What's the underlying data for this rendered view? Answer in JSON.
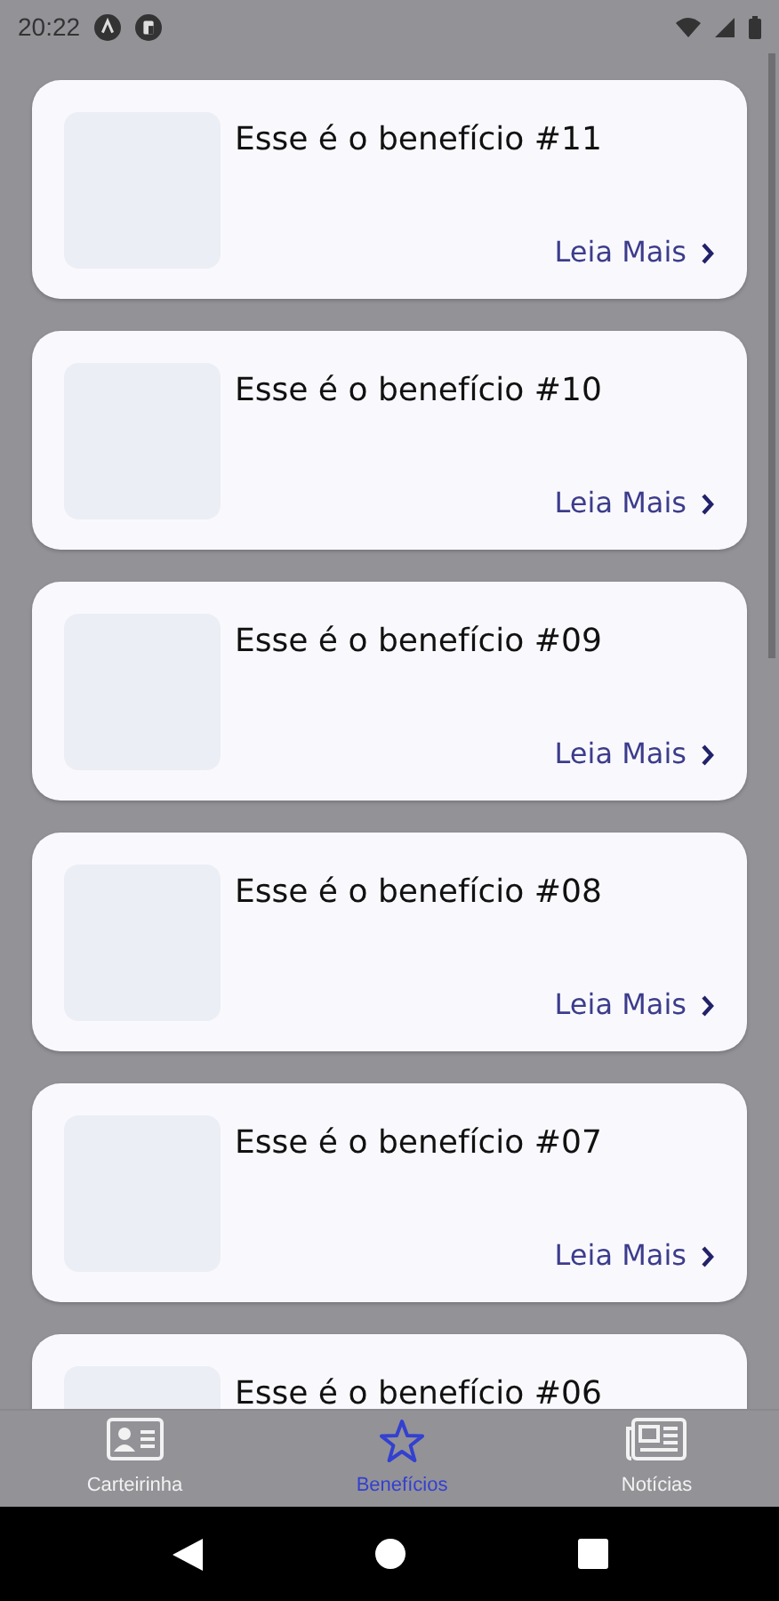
{
  "status_bar": {
    "time": "20:22"
  },
  "benefits": [
    {
      "title": "Esse é o benefício #11",
      "link": "Leia Mais"
    },
    {
      "title": "Esse é o benefício #10",
      "link": "Leia Mais"
    },
    {
      "title": "Esse é o benefício #09",
      "link": "Leia Mais"
    },
    {
      "title": "Esse é o benefício #08",
      "link": "Leia Mais"
    },
    {
      "title": "Esse é o benefício #07",
      "link": "Leia Mais"
    },
    {
      "title": "Esse é o benefício #06"
    }
  ],
  "bottom_nav": [
    {
      "label": "Carteirinha",
      "kind": "card",
      "selected": false
    },
    {
      "label": "Benefícios",
      "kind": "star",
      "selected": true
    },
    {
      "label": "Notícias",
      "kind": "news",
      "selected": false
    }
  ]
}
